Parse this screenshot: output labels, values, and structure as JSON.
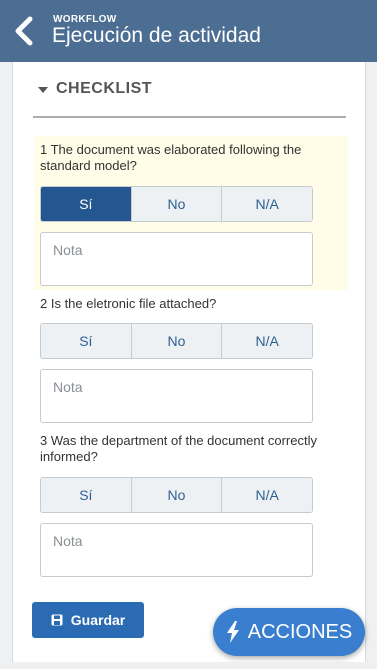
{
  "header": {
    "supertitle": "WORKFLOW",
    "title": "Ejecución de actividad",
    "bg_color": "#4b6e92"
  },
  "checklist": {
    "section_title": "CHECKLIST",
    "options": [
      "Sí",
      "No",
      "N/A"
    ],
    "note_placeholder": "Nota",
    "questions": [
      {
        "text": "1 The document was elaborated following the standard model?",
        "selected": "Sí"
      },
      {
        "text": "2 Is the eletronic file attached?",
        "selected": null
      },
      {
        "text": "3 Was the department of the document correctly informed?",
        "selected": null
      }
    ]
  },
  "actions": {
    "save_label": "Guardar",
    "acciones_label": "ACCIONES",
    "save_color": "#2b6bb3",
    "acciones_color": "#3a7fcf"
  }
}
